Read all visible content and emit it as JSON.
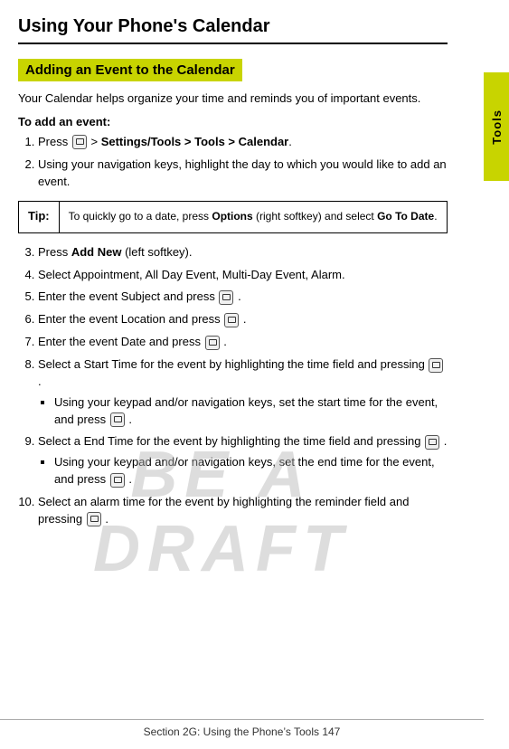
{
  "page": {
    "title": "Using Your Phone's Calendar",
    "sidebar_label": "Tools",
    "section_heading": "Adding an Event to the Calendar",
    "intro": "Your Calendar helps organize your time and reminds you of important events.",
    "to_add_label": "To add an event:",
    "steps": [
      {
        "id": 1,
        "text_parts": [
          "Press",
          " > ",
          "Settings/Tools",
          " > ",
          "Tools",
          " > ",
          "Calendar",
          "."
        ],
        "has_icon": true,
        "bold_segments": [
          "Settings/Tools > Tools > Calendar"
        ]
      },
      {
        "id": 2,
        "text": "Using your navigation keys, highlight the day to which you would like to add an event."
      },
      {
        "id": 3,
        "text_before": "Press ",
        "bold": "Add New",
        "text_after": " (left softkey)."
      },
      {
        "id": 4,
        "text": "Select Appointment, All Day Event, Multi-Day Event, Alarm."
      },
      {
        "id": 5,
        "text_before": "Enter the event Subject and press",
        "has_icon": true,
        "text_after": "."
      },
      {
        "id": 6,
        "text_before": "Enter the event Location and press",
        "has_icon": true,
        "text_after": "."
      },
      {
        "id": 7,
        "text_before": "Enter the event Date and press",
        "has_icon": true,
        "text_after": "."
      },
      {
        "id": 8,
        "text_before": "Select a Start Time for the event by highlighting the time field and pressing",
        "has_icon": true,
        "text_after": ".",
        "sub_bullets": [
          "Using your keypad and/or navigation keys, set the start time for the event, and press ⓐ."
        ]
      },
      {
        "id": 9,
        "text_before": "Select a End Time for the event by highlighting the time field and pressing",
        "has_icon": true,
        "text_after": ".",
        "sub_bullets": [
          "Using your keypad and/or navigation keys, set the end time for the event, and press ⓐ."
        ]
      },
      {
        "id": 10,
        "text_before": "Select an alarm time for the event by highlighting the reminder field and pressing",
        "has_icon": true,
        "text_after": "."
      }
    ],
    "tip": {
      "label": "Tip:",
      "text_before": "To quickly go to a date, press ",
      "bold": "Options",
      "text_middle": " (right softkey) and select ",
      "bold2": "Go To Date",
      "text_after": "."
    },
    "draft_watermark": "BE A DRAFT",
    "footer": "Section 2G: Using the Phone’s Tools       147"
  }
}
